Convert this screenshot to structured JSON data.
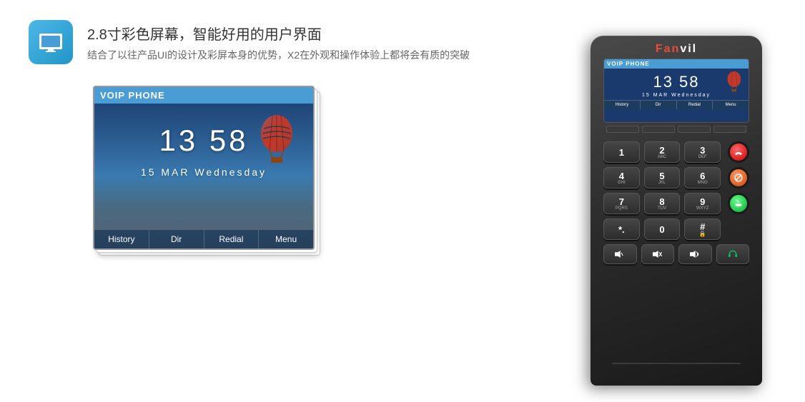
{
  "header": {
    "icon_alt": "display-icon",
    "title": "2.8寸彩色屏幕，智能好用的用户界面",
    "subtitle": "结合了以往产品UI的设计及彩屏本身的优势，X2在外观和操作体验上都将会有质的突破"
  },
  "screen": {
    "voip_label": "VOIP  PHONE",
    "time": "13  58",
    "date": "15   MAR   Wednesday",
    "buttons": {
      "history": "History",
      "dir": "Dir",
      "redial": "Redial",
      "menu": "Menu"
    }
  },
  "device": {
    "brand": "Fanvil",
    "keypad": [
      {
        "main": "1",
        "sub": ""
      },
      {
        "main": "2",
        "sub": "ABC"
      },
      {
        "main": "3",
        "sub": "DEF"
      },
      {
        "main": "4",
        "sub": "GHI"
      },
      {
        "main": "5",
        "sub": "JKL"
      },
      {
        "main": "6",
        "sub": "MNO"
      },
      {
        "main": "7",
        "sub": "PQRS"
      },
      {
        "main": "8",
        "sub": "TUV"
      },
      {
        "main": "9",
        "sub": "WXYZ"
      },
      {
        "main": "*.",
        "sub": ""
      },
      {
        "main": "0",
        "sub": ""
      },
      {
        "main": "#",
        "sub": "🔒"
      }
    ],
    "func_keys": [
      "< ◄",
      "(◄)",
      "◄ >",
      "🎧"
    ]
  },
  "colors": {
    "accent_blue": "#4a9cd4",
    "device_dark": "#2a2a2a",
    "brand_red": "#e74c3c"
  }
}
